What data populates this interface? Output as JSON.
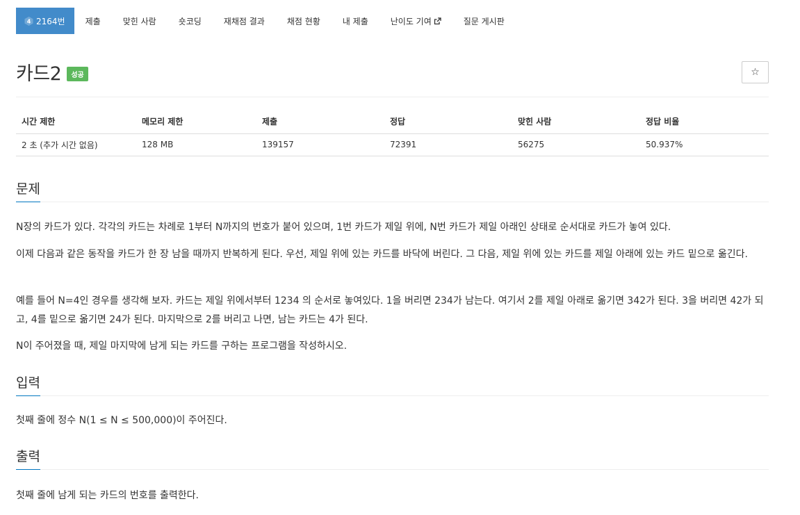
{
  "nav": {
    "problem_id": "2164번",
    "tier_level": "4",
    "items": [
      "제출",
      "맞힌 사람",
      "숏코딩",
      "재채점 결과",
      "채점 현황",
      "내 제출",
      "난이도 기여",
      "질문 게시판"
    ]
  },
  "problem": {
    "title": "카드2",
    "status_badge": "성공",
    "star": "☆"
  },
  "info_table": {
    "headers": [
      "시간 제한",
      "메모리 제한",
      "제출",
      "정답",
      "맞힌 사람",
      "정답 비율"
    ],
    "values": [
      "2 초 (추가 시간 없음)",
      "128 MB",
      "139157",
      "72391",
      "56275",
      "50.937%"
    ]
  },
  "sections": {
    "description_title": "문제",
    "description": [
      "N장의 카드가 있다. 각각의 카드는 차례로 1부터 N까지의 번호가 붙어 있으며, 1번 카드가 제일 위에, N번 카드가 제일 아래인 상태로 순서대로 카드가 놓여 있다.",
      "이제 다음과 같은 동작을 카드가 한 장 남을 때까지 반복하게 된다. 우선, 제일 위에 있는 카드를 바닥에 버린다. 그 다음, 제일 위에 있는 카드를 제일 아래에 있는 카드 밑으로 옮긴다.",
      "예를 들어 N=4인 경우를 생각해 보자. 카드는 제일 위에서부터 1234 의 순서로 놓여있다. 1을 버리면 234가 남는다. 여기서 2를 제일 아래로 옮기면 342가 된다. 3을 버리면 42가 되고, 4를 밑으로 옮기면 24가 된다. 마지막으로 2를 버리고 나면, 남는 카드는 4가 된다.",
      "N이 주어졌을 때, 제일 마지막에 남게 되는 카드를 구하는 프로그램을 작성하시오."
    ],
    "input_title": "입력",
    "input": "첫째 줄에 정수 N(1 ≤ N ≤ 500,000)이 주어진다.",
    "output_title": "출력",
    "output": "첫째 줄에 남게 되는 카드의 번호를 출력한다."
  },
  "colors": {
    "nav_active": "#428bca",
    "success_badge": "#5cb85c",
    "section_underline": "#0076c0"
  }
}
